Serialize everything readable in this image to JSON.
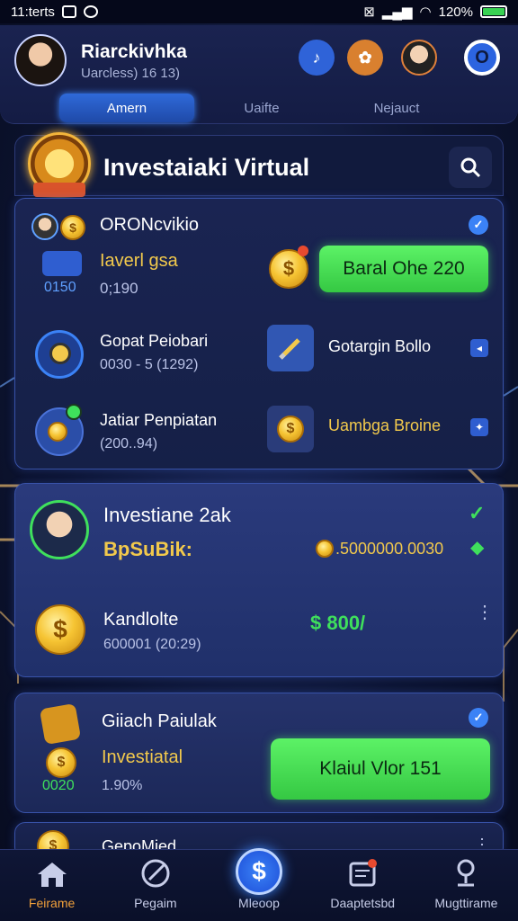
{
  "status_bar": {
    "time": "11:terts",
    "battery": "120%"
  },
  "header": {
    "user_name": "Riarckivhka",
    "user_sub": "Uarcless) 16 13)",
    "tabs": [
      {
        "label": "Amern"
      },
      {
        "label": "Uaifte"
      },
      {
        "label": "Nejauct"
      }
    ]
  },
  "panel": {
    "title": "Investaiaki Virtual"
  },
  "card1": {
    "name": "ORONcvikio",
    "label_gold": "Iaverl gsa",
    "left_value": "0150",
    "left_value2": "0;190",
    "button_label": "Baral Ohe 220",
    "row2_title": "Gopat Peiobari",
    "row2_sub": "0030 - 5 (1292)",
    "row2_right": "Gotargin Bollo",
    "row3_title": "Jatiar Penpiatan",
    "row3_sub": "(200..94)",
    "row3_right": "Uambga Broine"
  },
  "card2": {
    "title": "Investiane 2ak",
    "label_gold": "BpSuBik:",
    "balance": ".5000000.0030",
    "item_title": "Kandlolte",
    "item_sub": "600001 (20:29)",
    "item_amount": "$ 800/"
  },
  "card3": {
    "title": "Giiach Paiulak",
    "label_gold": "Investiatal",
    "left_value": "0020",
    "percent": "1.90%",
    "button_label": "Klaiul Vlor 151"
  },
  "card4": {
    "title": "GepoMied"
  },
  "bottom_nav": [
    {
      "label": "Feirame"
    },
    {
      "label": "Pegaim"
    },
    {
      "label": "Mleoop"
    },
    {
      "label": "Daaptetsbd"
    },
    {
      "label": "Mugttirame"
    }
  ],
  "colors": {
    "accent_green": "#3fe05c",
    "accent_blue": "#3b82f6",
    "gold": "#f2c94c"
  }
}
